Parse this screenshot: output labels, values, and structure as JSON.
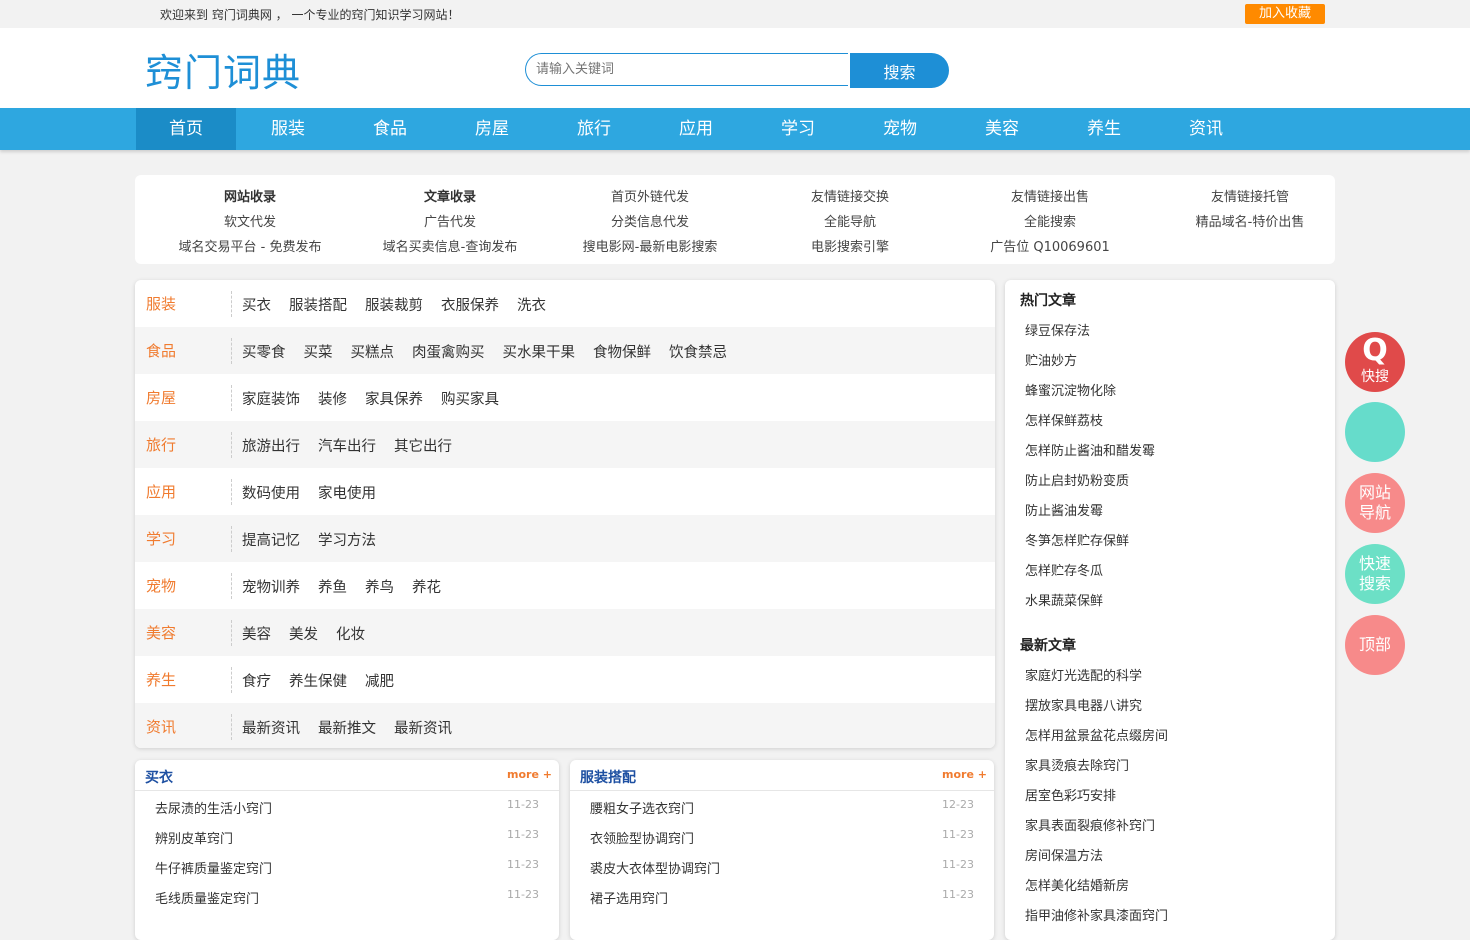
{
  "topbar": {
    "welcome": "欢迎来到 窍门词典网 ， 一个专业的窍门知识学习网站！",
    "favorite": "加入收藏"
  },
  "header": {
    "logo": "窍门词典",
    "search_placeholder": "请输入关键词",
    "search_button": "搜索"
  },
  "nav": [
    "首页",
    "服装",
    "食品",
    "房屋",
    "旅行",
    "应用",
    "学习",
    "宠物",
    "美容",
    "养生",
    "资讯"
  ],
  "links": [
    [
      "网站收录",
      "文章收录",
      "首页外链代发",
      "友情链接交换",
      "友情链接出售",
      "友情链接托管"
    ],
    [
      "软文代发",
      "广告代发",
      "分类信息代发",
      "全能导航",
      "全能搜索",
      "精品域名-特价出售"
    ],
    [
      "域名交易平台 - 免费发布",
      "域名买卖信息-查询发布",
      "搜电影网-最新电影搜索",
      "电影搜索引擎",
      "广告位 Q10069601",
      ""
    ]
  ],
  "categories": [
    {
      "name": "服装",
      "subs": [
        "买衣",
        "服装搭配",
        "服装裁剪",
        "衣服保养",
        "洗衣"
      ]
    },
    {
      "name": "食品",
      "subs": [
        "买零食",
        "买菜",
        "买糕点",
        "肉蛋禽购买",
        "买水果干果",
        "食物保鲜",
        "饮食禁忌"
      ]
    },
    {
      "name": "房屋",
      "subs": [
        "家庭装饰",
        "装修",
        "家具保养",
        "购买家具"
      ]
    },
    {
      "name": "旅行",
      "subs": [
        "旅游出行",
        "汽车出行",
        "其它出行"
      ]
    },
    {
      "name": "应用",
      "subs": [
        "数码使用",
        "家电使用"
      ]
    },
    {
      "name": "学习",
      "subs": [
        "提高记忆",
        "学习方法"
      ]
    },
    {
      "name": "宠物",
      "subs": [
        "宠物训养",
        "养鱼",
        "养鸟",
        "养花"
      ]
    },
    {
      "name": "美容",
      "subs": [
        "美容",
        "美发",
        "化妆"
      ]
    },
    {
      "name": "养生",
      "subs": [
        "食疗",
        "养生保健",
        "减肥"
      ]
    },
    {
      "name": "资讯",
      "subs": [
        "最新资讯",
        "最新推文",
        "最新资讯"
      ]
    }
  ],
  "boxes": [
    {
      "title": "买衣",
      "more": "more +",
      "items": [
        {
          "title": "去尿渍的生活小窍门",
          "date": "11-23"
        },
        {
          "title": "辨别皮革窍门",
          "date": "11-23"
        },
        {
          "title": "牛仔裤质量鉴定窍门",
          "date": "11-23"
        },
        {
          "title": "毛线质量鉴定窍门",
          "date": "11-23"
        }
      ]
    },
    {
      "title": "服装搭配",
      "more": "more +",
      "items": [
        {
          "title": "腰粗女子选衣窍门",
          "date": "12-23"
        },
        {
          "title": "衣领脸型协调窍门",
          "date": "11-23"
        },
        {
          "title": "裘皮大衣体型协调窍门",
          "date": "11-23"
        },
        {
          "title": "裙子选用窍门",
          "date": "11-23"
        }
      ]
    }
  ],
  "sidebar": {
    "hot_title": "热门文章",
    "hot": [
      "绿豆保存法",
      "贮油妙方",
      "蜂蜜沉淀物化除",
      "怎样保鲜荔枝",
      "怎样防止酱油和醋发霉",
      "防止启封奶粉变质",
      "防止酱油发霉",
      "冬笋怎样贮存保鲜",
      "怎样贮存冬瓜",
      "水果蔬菜保鲜"
    ],
    "new_title": "最新文章",
    "new": [
      "家庭灯光选配的科学",
      "摆放家具电器八讲究",
      "怎样用盆景盆花点缀房间",
      "家具烫痕去除窍门",
      "居室色彩巧安排",
      "家具表面裂痕修补窍门",
      "房间保温方法",
      "怎样美化结婚新房",
      "指甲油修补家具漆面窍门"
    ]
  },
  "floats": {
    "quick_search_icon": "Q",
    "quick_search": "快搜",
    "site_nav": [
      "网站",
      "导航"
    ],
    "fast_search": [
      "快速",
      "搜索"
    ],
    "top": "顶部"
  },
  "colors": {
    "brand": "#1e8fd6",
    "nav": "#2ea7e0",
    "accent": "#f07b2f",
    "float_red": "#e04a4a",
    "float_teal": "#66dccb",
    "float_pink": "#f78a8a",
    "float_green": "#6ce0c6"
  }
}
